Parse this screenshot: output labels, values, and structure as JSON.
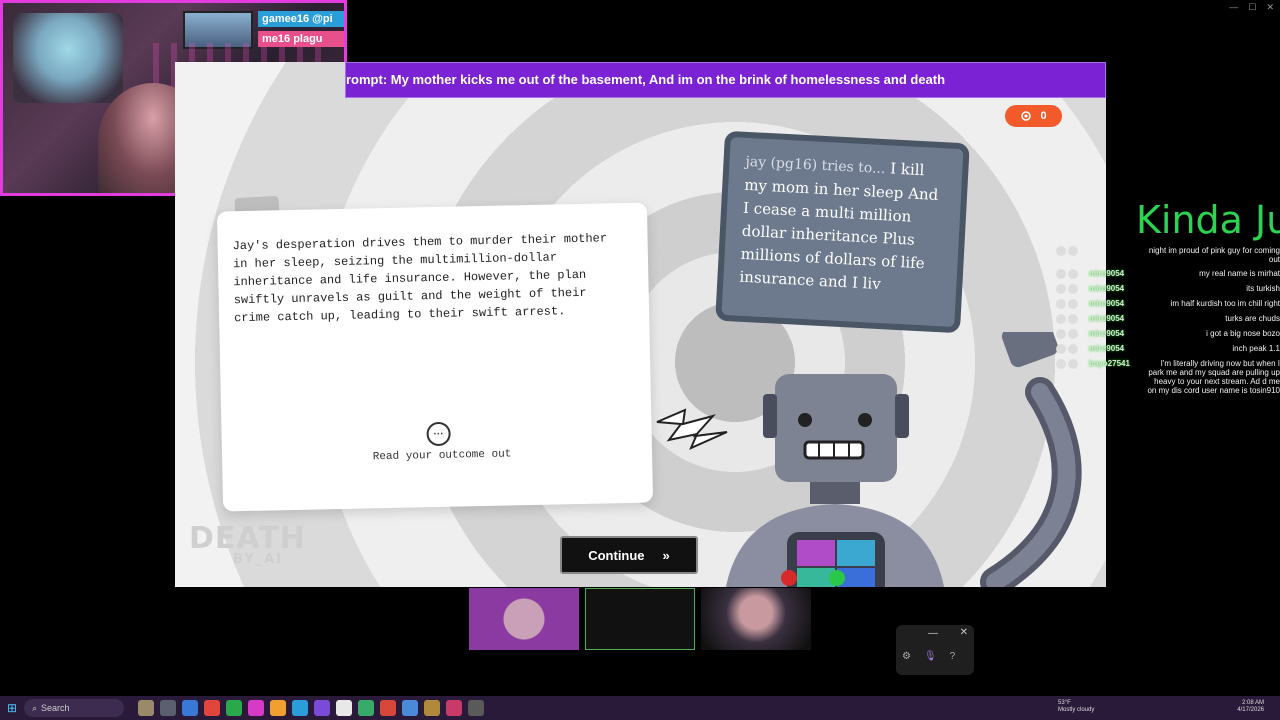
{
  "stream": {
    "tag1": "gamee16 @pi",
    "tag2": "me16 plagu"
  },
  "game": {
    "prompt": "rompt: My mother kicks me out of the basement, And im on the brink of homelessness and death",
    "counter_value": "0",
    "outcome_text": "Jay's desperation drives them to murder their mother in her sleep, seizing the multimillion-dollar inheritance and life insurance. However, the plan swiftly unravels as guilt and the weight of their crime catch up, leading to their swift arrest.",
    "read_outcome_label": "Read your outcome out",
    "speech_lead": "jay (pg16) tries to...",
    "speech_text": "I kill my mom in her sleep And I cease a multi million dollar inheritance Plus millions of dollars of life insurance and I liv",
    "logo_big": "DEATH",
    "logo_small": "BY_AI",
    "continue_label": "Continue",
    "colors": {
      "prompt_bar": "#7b22d4",
      "counter": "#f25a2a",
      "speech_bubble": "#6d7a8e"
    }
  },
  "chat": {
    "title": "Kinda Jus",
    "messages": [
      {
        "user": "",
        "text": "night im proud of pink guy for coming out"
      },
      {
        "user": "miro9054",
        "text": "my real name is mirhat"
      },
      {
        "user": "miro9054",
        "text": "its turkish"
      },
      {
        "user": "miro9054",
        "text": "im half kurdish too im chill right"
      },
      {
        "user": "miro9054",
        "text": "turks are chuds"
      },
      {
        "user": "miro9054",
        "text": "i got a big nose bozo"
      },
      {
        "user": "miro9054",
        "text": "inch peak 1.1"
      },
      {
        "user": "bayo27541",
        "text": "I'm literally driving now but when I park me and my squad are pulling up heavy to your next stream. Ad d me on my dis cord user name is tosin910"
      }
    ]
  },
  "taskbar": {
    "search_label": "Search",
    "weather_temp": "53°F",
    "weather_desc": "Mostly cloudy",
    "time": "2:08 AM",
    "date": "4/17/2026"
  }
}
